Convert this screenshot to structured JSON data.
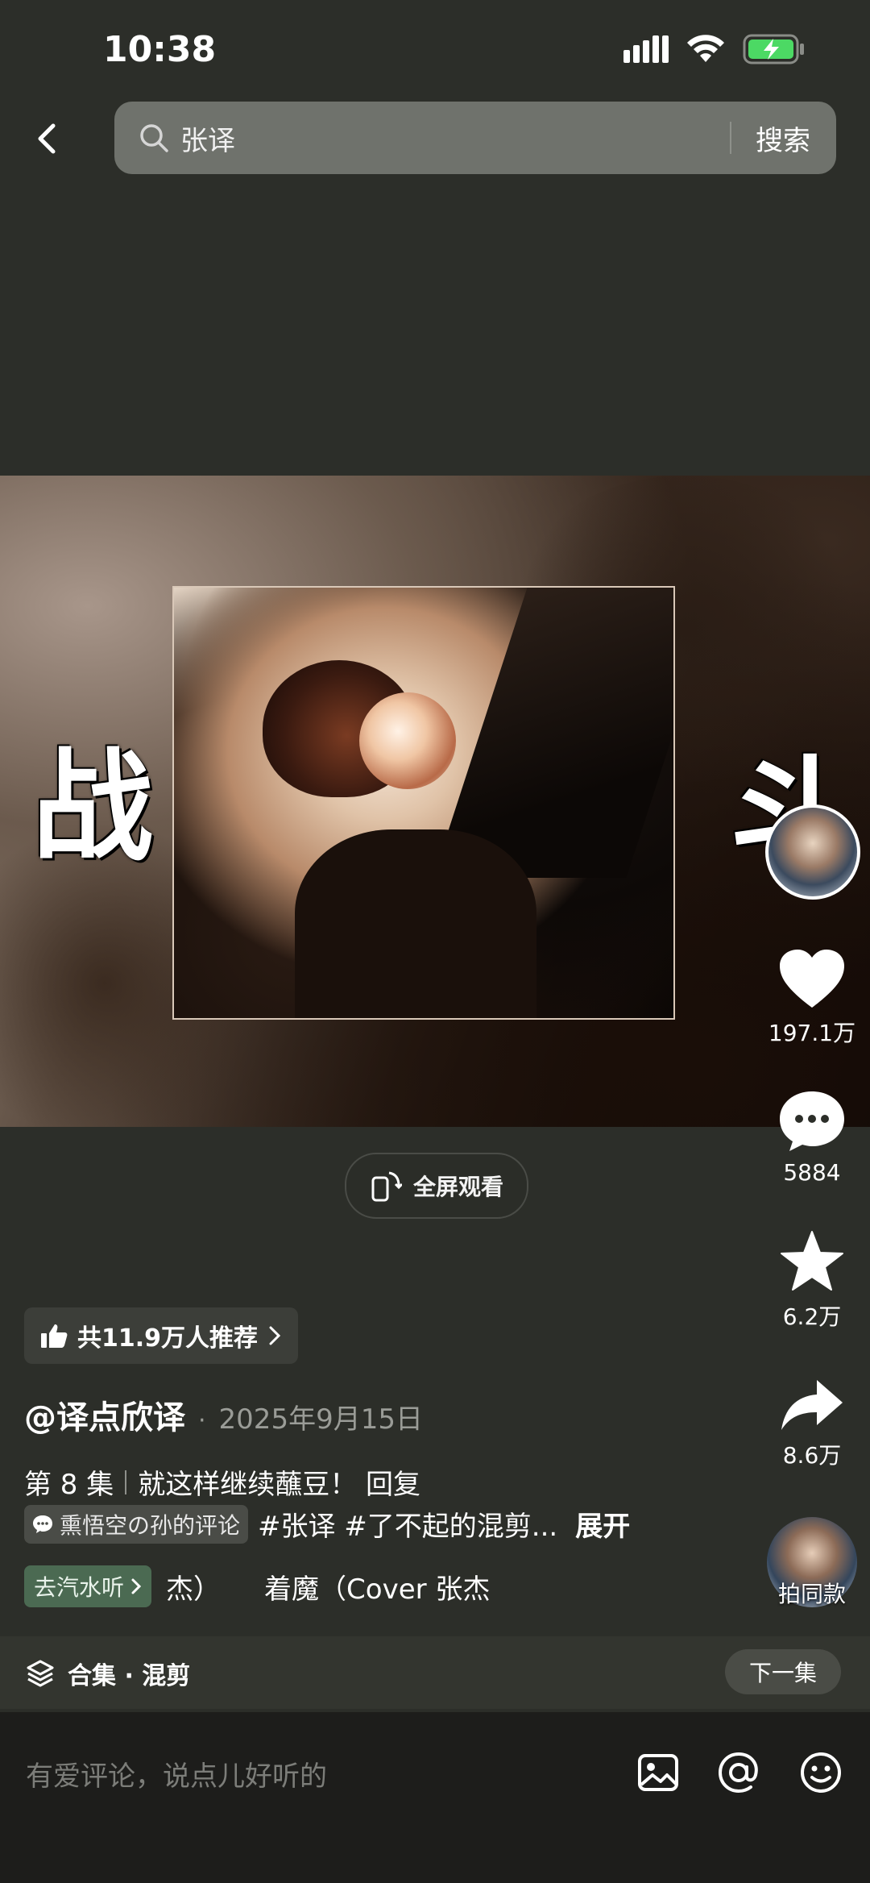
{
  "status": {
    "time": "10:38"
  },
  "search": {
    "query": "张译",
    "button": "搜索"
  },
  "video": {
    "left_char": "战",
    "right_char": "斗"
  },
  "fullscreen": {
    "label": "全屏观看"
  },
  "actions": {
    "likes": "197.1万",
    "comments": "5884",
    "favorites": "6.2万",
    "shares": "8.6万",
    "same_style": "拍同款"
  },
  "recommend": {
    "label": "共11.9万人推荐"
  },
  "post": {
    "author": "@译点欣译",
    "dot": "·",
    "date": "2025年9月15日",
    "episode": "第 8 集",
    "desc": "就这样继续蘸豆！  回复",
    "comment_tag": "熏悟空の孙的评论",
    "hashtags": "#张译 #了不起的混剪...",
    "expand": "展开"
  },
  "music": {
    "tag": "去汽水听",
    "text": "杰）     着魔（Cover 张杰"
  },
  "collection": {
    "label": "合集 · 混剪",
    "next": "下一集"
  },
  "comment_input": {
    "placeholder": "有爱评论，说点儿好听的"
  },
  "colors": {
    "background": "#2c2e29",
    "search_bg": "#6f726c",
    "music_tag": "#4b6a52"
  }
}
